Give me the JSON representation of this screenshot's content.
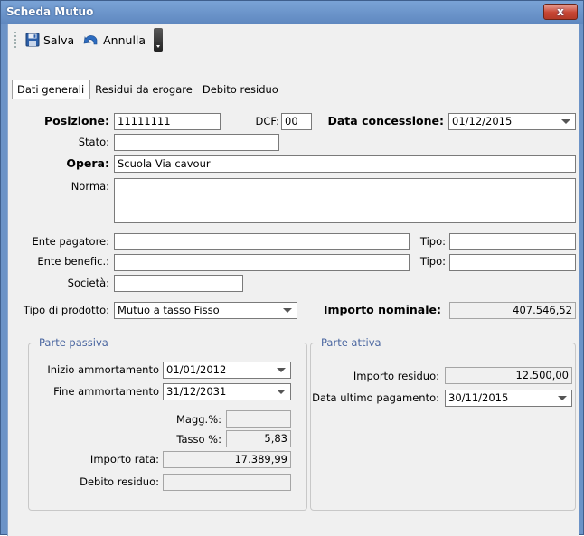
{
  "window": {
    "title": "Scheda Mutuo",
    "close_label": "x"
  },
  "toolbar": {
    "save_label": "Salva",
    "undo_label": "Annulla"
  },
  "tabs": [
    {
      "label": "Dati generali"
    },
    {
      "label": "Residui da erogare"
    },
    {
      "label": "Debito residuo"
    }
  ],
  "form": {
    "posizione": {
      "label": "Posizione:",
      "value": "11111111"
    },
    "dcf": {
      "label": "DCF:",
      "value": "00"
    },
    "data_concessione": {
      "label": "Data concessione:",
      "value": "01/12/2015"
    },
    "stato": {
      "label": "Stato:",
      "value": ""
    },
    "opera": {
      "label": "Opera:",
      "value": "Scuola Via cavour"
    },
    "norma": {
      "label": "Norma:",
      "value": ""
    },
    "ente_pagatore": {
      "label": "Ente pagatore:",
      "value": "",
      "tipo_label": "Tipo:",
      "tipo_value": ""
    },
    "ente_benefic": {
      "label": "Ente benefic.:",
      "value": "",
      "tipo_label": "Tipo:",
      "tipo_value": ""
    },
    "societa": {
      "label": "Società:",
      "value": ""
    },
    "tipo_prodotto": {
      "label": "Tipo di prodotto:",
      "value": "Mutuo a tasso Fisso"
    },
    "importo_nominale": {
      "label": "Importo nominale:",
      "value": "407.546,52"
    }
  },
  "parte_passiva": {
    "title": "Parte passiva",
    "inizio_ammortamento": {
      "label": "Inizio ammortamento",
      "value": "01/01/2012"
    },
    "fine_ammortamento": {
      "label": "Fine ammortamento",
      "value": "31/12/2031"
    },
    "magg": {
      "label": "Magg.%:",
      "value": ""
    },
    "tasso": {
      "label": "Tasso %:",
      "value": "5,83"
    },
    "importo_rata": {
      "label": "Importo rata:",
      "value": "17.389,99"
    },
    "debito_residuo": {
      "label": "Debito residuo:",
      "value": ""
    }
  },
  "parte_attiva": {
    "title": "Parte attiva",
    "importo_residuo": {
      "label": "Importo residuo:",
      "value": "12.500,00"
    },
    "data_ultimo_pagamento": {
      "label": "Data ultimo pagamento:",
      "value": "30/11/2015"
    }
  },
  "colors": {
    "title_bar": "#6c93c7",
    "close": "#c74634",
    "group_title": "#4a66a0"
  }
}
